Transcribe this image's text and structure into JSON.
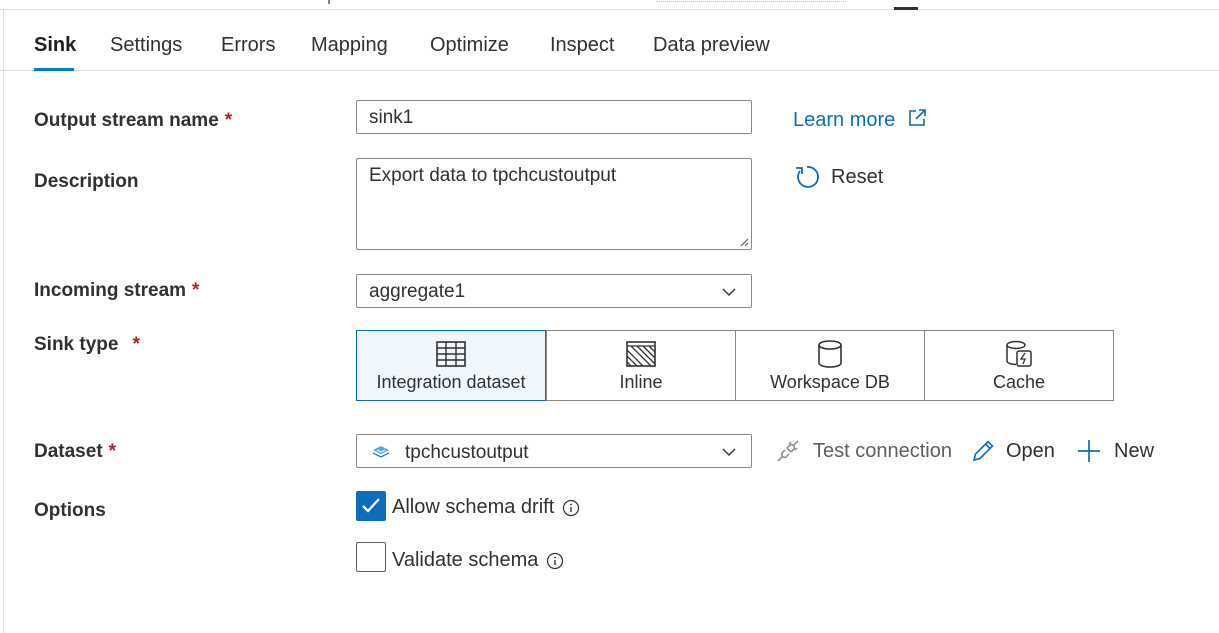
{
  "tabs": [
    {
      "label": "Sink",
      "active": true
    },
    {
      "label": "Settings"
    },
    {
      "label": "Errors"
    },
    {
      "label": "Mapping"
    },
    {
      "label": "Optimize"
    },
    {
      "label": "Inspect"
    },
    {
      "label": "Data preview"
    }
  ],
  "form": {
    "required_mark": "*",
    "output_stream": {
      "label": "Output stream name",
      "value": "sink1"
    },
    "learn_more": {
      "label": "Learn more",
      "icon": "external-link-icon"
    },
    "description": {
      "label": "Description",
      "value": "Export data to tpchcustoutput"
    },
    "reset": {
      "label": "Reset",
      "icon": "refresh-icon"
    },
    "incoming_stream": {
      "label": "Incoming stream",
      "value": "aggregate1"
    },
    "sink_type": {
      "label": "Sink type",
      "options": [
        {
          "label": "Integration dataset",
          "icon": "table-icon",
          "selected": true
        },
        {
          "label": "Inline",
          "icon": "hatched-square-icon"
        },
        {
          "label": "Workspace DB",
          "icon": "database-icon"
        },
        {
          "label": "Cache",
          "icon": "cache-icon"
        }
      ]
    },
    "dataset": {
      "label": "Dataset",
      "value": "tpchcustoutput",
      "icon": "dataset-icon"
    },
    "test_connection": {
      "label": "Test connection",
      "icon": "plug-icon"
    },
    "open": {
      "label": "Open",
      "icon": "pencil-icon"
    },
    "new": {
      "label": "New",
      "icon": "plus-icon"
    },
    "options": {
      "label": "Options",
      "allow_schema_drift": {
        "label": "Allow schema drift",
        "checked": true
      },
      "validate_schema": {
        "label": "Validate schema",
        "checked": false
      }
    }
  },
  "colors": {
    "accent": "#0f6cbd",
    "required": "#a4262c",
    "tab_underline": "#0078d4"
  }
}
